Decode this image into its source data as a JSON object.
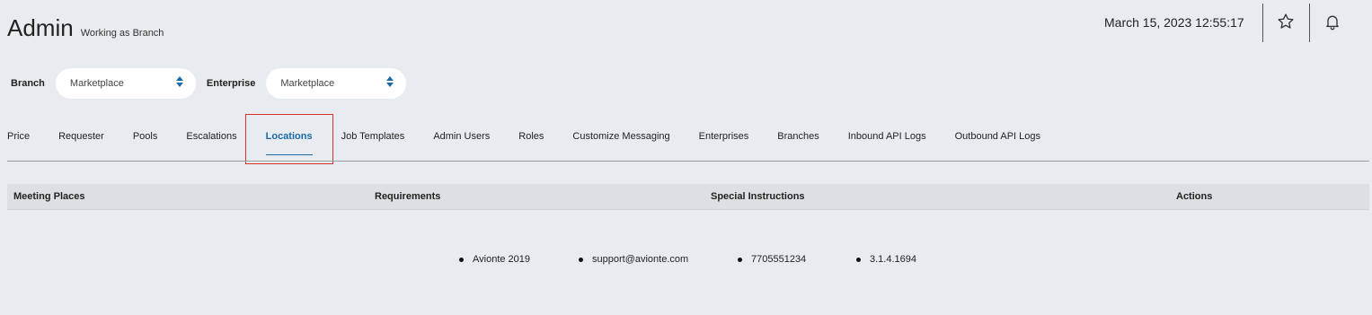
{
  "header": {
    "title": "Admin",
    "subtitle": "Working as Branch",
    "datetime": "March 15, 2023 12:55:17",
    "icons": [
      "star-icon",
      "bell-icon"
    ]
  },
  "filters": {
    "branch_label": "Branch",
    "branch_value": "Marketplace",
    "enterprise_label": "Enterprise",
    "enterprise_value": "Marketplace"
  },
  "tabs": [
    {
      "label": "Price"
    },
    {
      "label": "Requester"
    },
    {
      "label": "Pools"
    },
    {
      "label": "Escalations"
    },
    {
      "label": "Locations",
      "active": true
    },
    {
      "label": "Job Templates"
    },
    {
      "label": "Admin Users"
    },
    {
      "label": "Roles"
    },
    {
      "label": "Customize Messaging"
    },
    {
      "label": "Enterprises"
    },
    {
      "label": "Branches"
    },
    {
      "label": "Inbound API Logs"
    },
    {
      "label": "Outbound API Logs"
    }
  ],
  "table": {
    "columns": [
      "Meeting Places",
      "Requirements",
      "Special Instructions",
      "Actions"
    ]
  },
  "footer": {
    "items": [
      "Avionte 2019",
      "support@avionte.com",
      "7705551234",
      "3.1.4.1694"
    ]
  },
  "colors": {
    "accent": "#1a6aa8",
    "highlight": "#d9302a",
    "background": "#e8ebef"
  }
}
